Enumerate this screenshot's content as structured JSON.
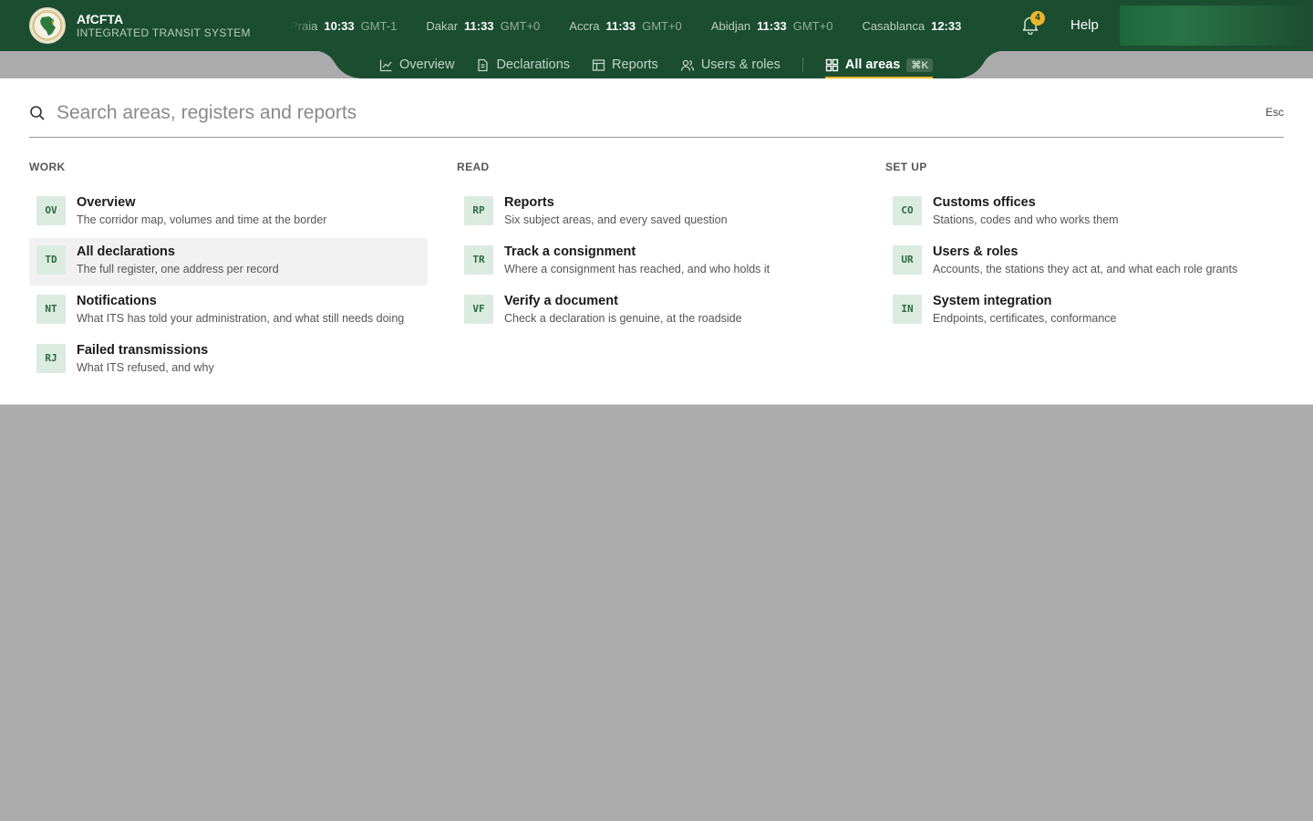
{
  "brand": {
    "name": "AfCFTA",
    "subtitle": "INTEGRATED TRANSIT SYSTEM"
  },
  "clocks": [
    {
      "city": "Praia",
      "time": "10:33",
      "tz": "GMT-1"
    },
    {
      "city": "Dakar",
      "time": "11:33",
      "tz": "GMT+0"
    },
    {
      "city": "Accra",
      "time": "11:33",
      "tz": "GMT+0"
    },
    {
      "city": "Abidjan",
      "time": "11:33",
      "tz": "GMT+0"
    },
    {
      "city": "Casablanca",
      "time": "12:33",
      "tz": ""
    }
  ],
  "header": {
    "notification_count": "4",
    "help_label": "Help"
  },
  "tabs": {
    "overview": "Overview",
    "declarations": "Declarations",
    "reports": "Reports",
    "users_roles": "Users & roles",
    "all_areas": "All areas",
    "all_areas_shortcut": "⌘K"
  },
  "search": {
    "placeholder": "Search areas, registers and reports",
    "esc_label": "Esc"
  },
  "columns": [
    {
      "title": "WORK",
      "items": [
        {
          "code": "OV",
          "title": "Overview",
          "desc": "The corridor map, volumes and time at the border"
        },
        {
          "code": "TD",
          "title": "All declarations",
          "desc": "The full register, one address per record"
        },
        {
          "code": "NT",
          "title": "Notifications",
          "desc": "What ITS has told your administration, and what still needs doing"
        },
        {
          "code": "RJ",
          "title": "Failed transmissions",
          "desc": "What ITS refused, and why"
        }
      ]
    },
    {
      "title": "READ",
      "items": [
        {
          "code": "RP",
          "title": "Reports",
          "desc": "Six subject areas, and every saved question"
        },
        {
          "code": "TR",
          "title": "Track a consignment",
          "desc": "Where a consignment has reached, and who holds it"
        },
        {
          "code": "VF",
          "title": "Verify a document",
          "desc": "Check a declaration is genuine, at the roadside"
        }
      ]
    },
    {
      "title": "SET UP",
      "items": [
        {
          "code": "CO",
          "title": "Customs offices",
          "desc": "Stations, codes and who works them"
        },
        {
          "code": "UR",
          "title": "Users & roles",
          "desc": "Accounts, the stations they act at, and what each role grants"
        },
        {
          "code": "IN",
          "title": "System integration",
          "desc": "Endpoints, certificates, conformance"
        }
      ]
    }
  ],
  "colors": {
    "header_bg": "#1b4d30",
    "accent": "#e8b62c",
    "code_bg": "#dcebe0",
    "code_text": "#2a6a3f",
    "backdrop": "#ababab"
  }
}
